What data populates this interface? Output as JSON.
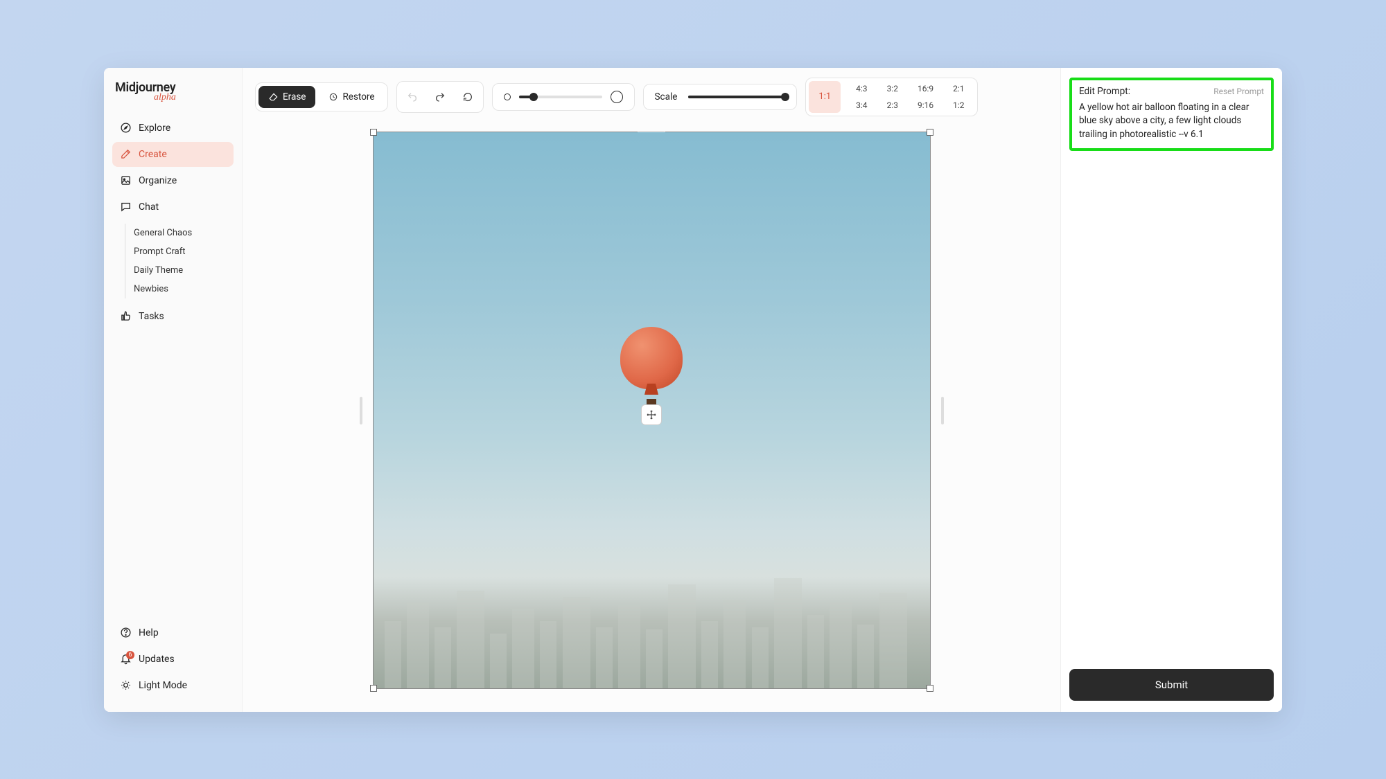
{
  "logo": {
    "main": "Midjourney",
    "sub": "alpha"
  },
  "sidebar": {
    "explore": "Explore",
    "create": "Create",
    "organize": "Organize",
    "chat": "Chat",
    "chat_items": [
      "General Chaos",
      "Prompt Craft",
      "Daily Theme",
      "Newbies"
    ],
    "tasks": "Tasks",
    "help": "Help",
    "updates": "Updates",
    "updates_badge": "6",
    "light_mode": "Light Mode"
  },
  "toolbar": {
    "erase": "Erase",
    "restore": "Restore",
    "scale": "Scale"
  },
  "ratios": {
    "current": "1:1",
    "grid": [
      "4:3",
      "3:2",
      "16:9",
      "2:1",
      "3:4",
      "2:3",
      "9:16",
      "1:2"
    ]
  },
  "prompt": {
    "title": "Edit Prompt:",
    "reset": "Reset Prompt",
    "text": "A yellow hot air balloon floating in a clear blue sky above a city, a few light clouds trailing in photorealistic --v 6.1"
  },
  "submit": "Submit"
}
